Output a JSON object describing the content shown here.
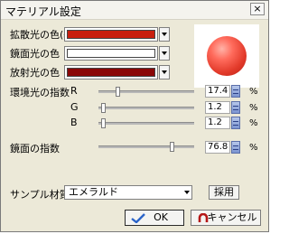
{
  "window": {
    "title": "マテリアル設定",
    "close_label": "×"
  },
  "colors": {
    "diffuse": {
      "label": "拡散光の色(基本色)",
      "swatch": "#c81e0e"
    },
    "specular": {
      "label": "鏡面光の色",
      "swatch": "#ffffff"
    },
    "emissive": {
      "label": "放射光の色",
      "swatch": "#8a0707"
    }
  },
  "ambient": {
    "label": "環境光の指数",
    "channels": [
      {
        "name": "R",
        "value": "17.4",
        "fraction": 0.174
      },
      {
        "name": "G",
        "value": "1.2",
        "fraction": 0.012
      },
      {
        "name": "B",
        "value": "1.2",
        "fraction": 0.012
      }
    ]
  },
  "specular_index": {
    "label": "鏡面の指数",
    "value": "76.8",
    "fraction": 0.768
  },
  "percent_symbol": "%",
  "sample": {
    "label": "サンプル材質",
    "selected": "エメラルド",
    "apply_label": "採用"
  },
  "buttons": {
    "ok": "OK",
    "cancel": "キャンセル"
  }
}
